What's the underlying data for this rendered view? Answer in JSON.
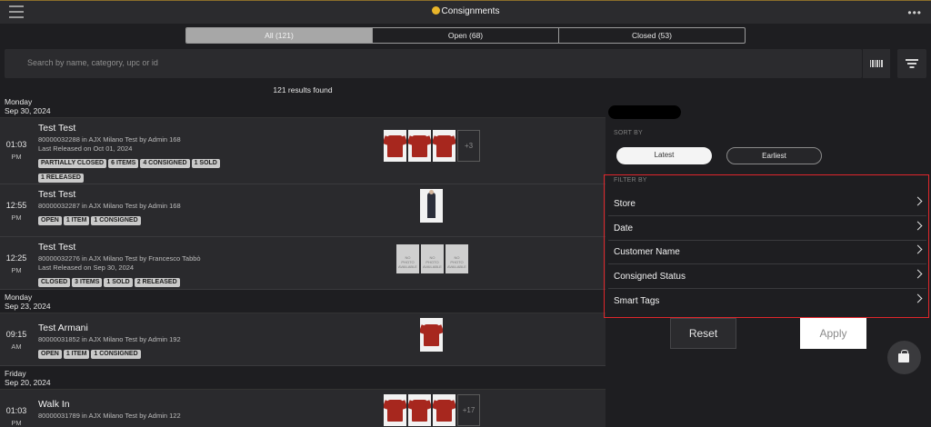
{
  "header": {
    "title": "Consignments"
  },
  "tabs": [
    {
      "label": "All (121)",
      "active": true
    },
    {
      "label": "Open (68)",
      "active": false
    },
    {
      "label": "Closed (53)",
      "active": false
    }
  ],
  "search": {
    "placeholder": "Search by name, category, upc or id",
    "value": ""
  },
  "results_text": "121 results found",
  "list": {
    "days": [
      {
        "weekday": "Monday",
        "date": "Sep 30, 2024"
      },
      {
        "weekday": "Monday",
        "date": "Sep 23, 2024"
      },
      {
        "weekday": "Friday",
        "date": "Sep 20, 2024"
      }
    ],
    "rows": [
      {
        "time": "01:03",
        "ampm": "PM",
        "title": "Test Test",
        "line1": "80000032288 in AJX Milano Test by Admin 168",
        "line2": "Last Released on Oct 01, 2024",
        "tags": [
          "PARTIALLY CLOSED",
          "6 ITEMS",
          "4 CONSIGNED",
          "1 SOLD",
          "1 RELEASED"
        ],
        "more": "+3"
      },
      {
        "time": "12:55",
        "ampm": "PM",
        "title": "Test Test",
        "line1": "80000032287 in AJX Milano Test by Admin 168",
        "line2": "",
        "tags": [
          "OPEN",
          "1 ITEM",
          "1 CONSIGNED"
        ]
      },
      {
        "time": "12:25",
        "ampm": "PM",
        "title": "Test Test",
        "line1": "80000032276 in AJX Milano Test by Francesco Tabbò",
        "line2": "Last Released on Sep 30, 2024",
        "tags": [
          "CLOSED",
          "3 ITEMS",
          "1 SOLD",
          "2 RELEASED"
        ],
        "noimg": "NO PHOTO AVAILABLE"
      },
      {
        "time": "09:15",
        "ampm": "AM",
        "title": "Test Armani",
        "line1": "80000031852 in AJX Milano Test by Admin 192",
        "line2": "",
        "tags": [
          "OPEN",
          "1 ITEM",
          "1 CONSIGNED"
        ]
      },
      {
        "time": "01:03",
        "ampm": "PM",
        "title": "Walk In",
        "line1": "80000031789 in AJX Milano Test by Admin 122",
        "line2": "",
        "tags": [],
        "more": "+17"
      }
    ]
  },
  "panel": {
    "sort_label": "SORT BY",
    "sort_options": [
      "Latest",
      "Earliest"
    ],
    "filter_label": "FILTER BY",
    "filters": [
      "Store",
      "Date",
      "Customer Name",
      "Consigned Status",
      "Smart Tags"
    ],
    "reset_label": "Reset",
    "apply_label": "Apply"
  },
  "colors": {
    "background": "#1e1e21",
    "row": "#2a2a2d",
    "highlight_border": "#e0262b",
    "tag": "#c9c9c9"
  }
}
